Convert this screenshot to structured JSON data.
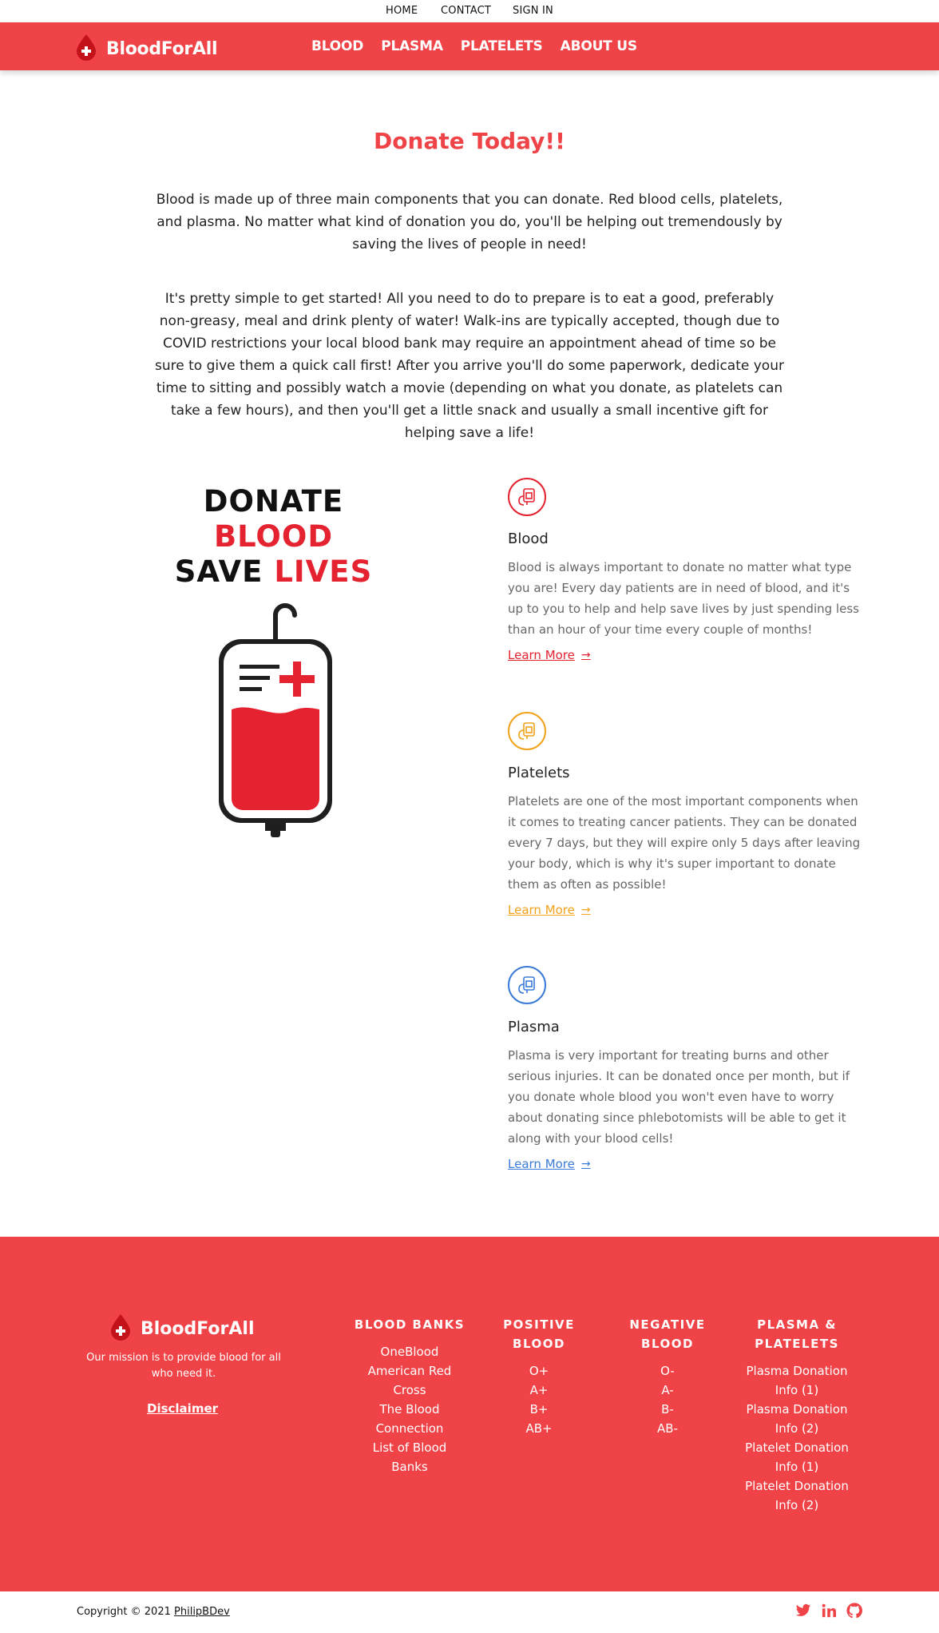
{
  "topnav": {
    "items": [
      "HOME",
      "CONTACT",
      "SIGN IN"
    ]
  },
  "header": {
    "brand": "BloodForAll",
    "nav": [
      "BLOOD",
      "PLASMA",
      "PLATELETS",
      "ABOUT US"
    ],
    "color": "#ef4347"
  },
  "intro": {
    "title": "Donate Today!!",
    "p1": "Blood is made up of three main components that you can donate. Red blood cells, platelets, and plasma. No matter what kind of donation you do, you'll be helping out tremendously by saving the lives of people in need!",
    "p2": "It's pretty simple to get started! All you need to do to prepare is to eat a good, preferably non-greasy, meal and drink plenty of water! Walk-ins are typically accepted, though due to COVID restrictions your local blood bank may require an appointment ahead of time so be sure to give them a quick call first! After you arrive you'll do some paperwork, dedicate your time to sitting and possibly watch a movie (depending on what you donate, as platelets can take a few hours), and then you'll get a little snack and usually a small incentive gift for helping save a life!"
  },
  "poster": {
    "line1_black": "DONATE",
    "line1_red": "BLOOD",
    "line2_black": "SAVE",
    "line2_red": "LIVES"
  },
  "features": [
    {
      "title": "Blood",
      "text": "Blood is always important to donate no matter what type you are! Every day patients are in need of blood, and it's up to you to help and help save lives by just spending less than an hour of your time every couple of months!",
      "link": "Learn More",
      "color": "#e5222f",
      "icon": "blood-bag-icon"
    },
    {
      "title": "Platelets",
      "text": "Platelets are one of the most important components when it comes to treating cancer patients. They can be donated every 7 days, but they will expire only 5 days after leaving your body, which is why it's super important to donate them as often as possible!",
      "link": "Learn More",
      "color": "#f0a21b",
      "icon": "blood-bag-icon"
    },
    {
      "title": "Plasma",
      "text": "Plasma is very important for treating burns and other serious injuries. It can be donated once per month, but if you donate whole blood you won't even have to worry about donating since phlebotomists will be able to get it along with your blood cells!",
      "link": "Learn More",
      "color": "#3b7bd8",
      "icon": "blood-bag-icon"
    }
  ],
  "footer": {
    "brand": "BloodForAll",
    "mission": "Our mission is to provide blood for all who need it.",
    "disclaimer": "Disclaimer",
    "columns": [
      {
        "title": "BLOOD BANKS",
        "items": [
          "OneBlood",
          "American Red Cross",
          "The Blood Connection",
          "List of Blood Banks"
        ]
      },
      {
        "title": "POSITIVE BLOOD",
        "items": [
          "O+",
          "A+",
          "B+",
          "AB+"
        ]
      },
      {
        "title": "NEGATIVE BLOOD",
        "items": [
          "O-",
          "A-",
          "B-",
          "AB-"
        ]
      },
      {
        "title": "PLASMA & PLATELETS",
        "items": [
          "Plasma Donation Info (1)",
          "Plasma Donation Info (2)",
          "Platelet Donation Info (1)",
          "Platelet Donation Info (2)"
        ]
      }
    ]
  },
  "bottom": {
    "copyright": "Copyright © 2021",
    "owner": "PhilipBDev",
    "social": [
      "twitter-icon",
      "linkedin-icon",
      "github-icon"
    ]
  }
}
